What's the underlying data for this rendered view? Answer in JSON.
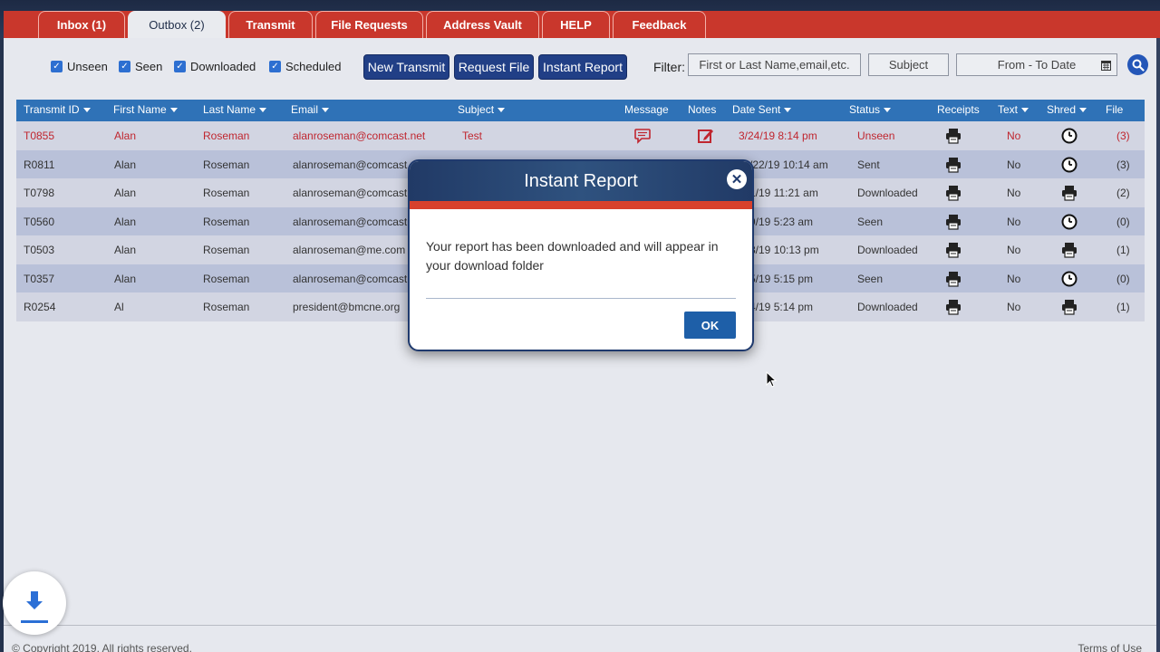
{
  "tabs": [
    {
      "label": "Inbox (1)",
      "active": false
    },
    {
      "label": "Outbox (2)",
      "active": true
    },
    {
      "label": "Transmit",
      "active": false
    },
    {
      "label": "File Requests",
      "active": false
    },
    {
      "label": "Address Vault",
      "active": false
    },
    {
      "label": "HELP",
      "active": false
    },
    {
      "label": "Feedback",
      "active": false
    }
  ],
  "checkboxes": [
    {
      "label": "Unseen",
      "checked": true
    },
    {
      "label": "Seen",
      "checked": true
    },
    {
      "label": "Downloaded",
      "checked": true
    },
    {
      "label": "Scheduled",
      "checked": true
    }
  ],
  "buttons": {
    "new_transmit": "New Transmit",
    "request_file": "Request File",
    "instant_report": "Instant Report"
  },
  "filter": {
    "label": "Filter:",
    "name_placeholder": "First or Last Name,email,etc.",
    "subject_placeholder": "Subject",
    "date_placeholder": "From - To Date"
  },
  "table": {
    "columns": [
      "Transmit ID",
      "First Name",
      "Last Name",
      "Email",
      "Subject",
      "Message",
      "Notes",
      "Date Sent",
      "Status",
      "Receipts",
      "Text",
      "Shred",
      "File"
    ],
    "rows": [
      {
        "id": "T0855",
        "first": "Alan",
        "last": "Roseman",
        "email": "alanroseman@comcast.net",
        "subject": "Test",
        "date": "3/24/19 8:14 pm",
        "status": "Unseen",
        "text": "No",
        "shred": "clock-icon",
        "file": "(3)"
      },
      {
        "id": "R0811",
        "first": "Alan",
        "last": "Roseman",
        "email": "alanroseman@comcast.net",
        "subject": "",
        "date": "/22/19 10:14 am",
        "status": "Sent",
        "text": "No",
        "shred": "clock-icon",
        "file": "(3)"
      },
      {
        "id": "T0798",
        "first": "Alan",
        "last": "Roseman",
        "email": "alanroseman@comcast.n",
        "subject": "",
        "date": "1/19 11:21 am",
        "status": "Downloaded",
        "text": "No",
        "shred": "printer-icon",
        "file": "(2)"
      },
      {
        "id": "T0560",
        "first": "Alan",
        "last": "Roseman",
        "email": "alanroseman@comcast.n",
        "subject": "",
        "date": "9/19 5:23 am",
        "status": "Seen",
        "text": "No",
        "shred": "clock-icon",
        "file": "(0)"
      },
      {
        "id": "T0503",
        "first": "Alan",
        "last": "Roseman",
        "email": "alanroseman@me.com",
        "subject": "",
        "date": "8/19 10:13 pm",
        "status": "Downloaded",
        "text": "No",
        "shred": "printer-icon",
        "file": "(1)"
      },
      {
        "id": "T0357",
        "first": "Alan",
        "last": "Roseman",
        "email": "alanroseman@comcast.n",
        "subject": "",
        "date": "5/19 5:15 pm",
        "status": "Seen",
        "text": "No",
        "shred": "clock-icon",
        "file": "(0)"
      },
      {
        "id": "R0254",
        "first": "Al",
        "last": "Roseman",
        "email": "president@bmcne.org",
        "subject": "",
        "date": "4/19 5:14 pm",
        "status": "Downloaded",
        "text": "No",
        "shred": "printer-icon",
        "file": "(1)"
      }
    ]
  },
  "modal": {
    "title": "Instant Report",
    "message": "Your report has been downloaded and will appear in your download folder",
    "ok": "OK"
  },
  "footer": {
    "copyright": "© Copyright 2019. All rights reserved.",
    "terms": "Terms of Use"
  },
  "colors": {
    "tab_red": "#c9372c",
    "header_blue": "#2f72b7",
    "button_navy": "#213f86",
    "alert_red": "#c0262f"
  }
}
